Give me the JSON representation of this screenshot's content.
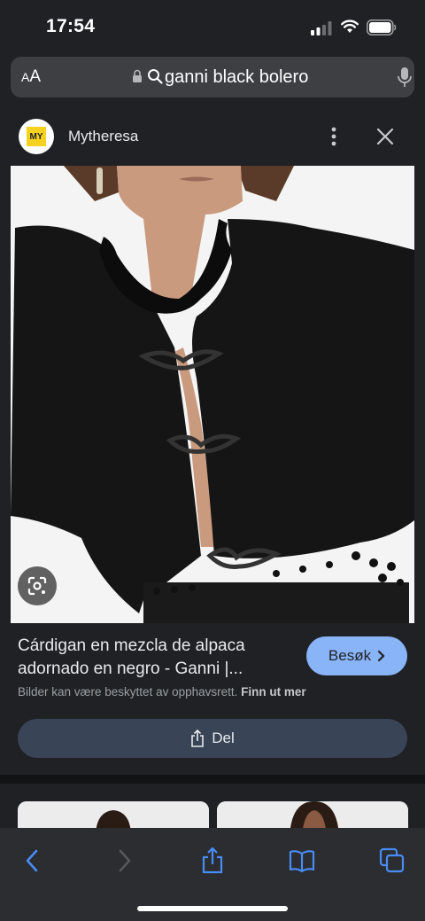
{
  "status_bar": {
    "time": "17:54"
  },
  "address_bar": {
    "text_size_label_big": "A",
    "text_size_label_small": "A",
    "url": "ganni black bolero"
  },
  "source": {
    "logo_text": "MY",
    "name": "Mytheresa"
  },
  "product": {
    "title": "Cárdigan en mezcla de alpaca adornado en negro - Ganni |...",
    "visit_label": "Besøk",
    "copyright_text": "Bilder kan være beskyttet av opphavsrett.",
    "copyright_link": "Finn ut mer",
    "share_label": "Del"
  },
  "colors": {
    "accent": "#8ab4f8",
    "background": "#1f2124",
    "share_bg": "#394457",
    "toolbar_icons": "#4a8cf7"
  },
  "icons": [
    "lock-icon",
    "search-icon",
    "mic-icon",
    "more-icon",
    "close-icon",
    "lens-icon",
    "share-icon",
    "back-icon",
    "forward-icon",
    "bookmarks-icon",
    "tabs-icon"
  ]
}
